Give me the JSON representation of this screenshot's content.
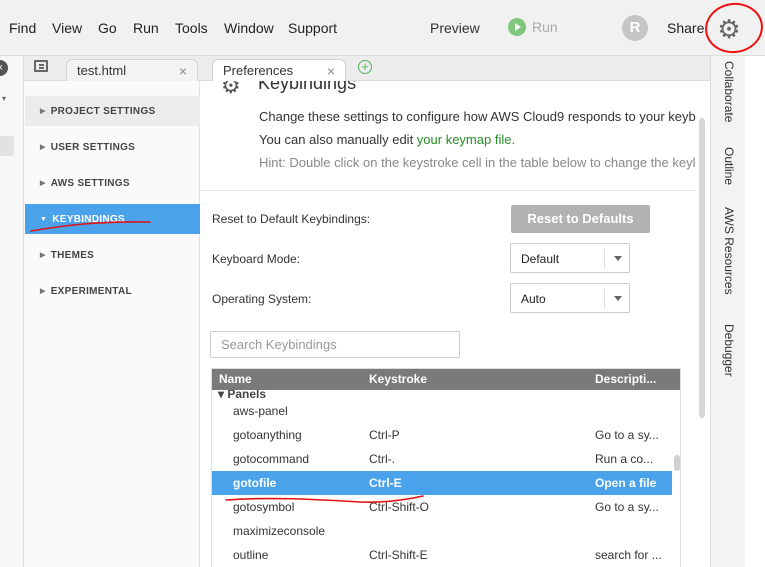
{
  "menubar": {
    "items": [
      "Find",
      "View",
      "Go",
      "Run",
      "Tools",
      "Window",
      "Support"
    ],
    "preview": "Preview",
    "run": "Run",
    "avatar_letter": "R",
    "share": "Share",
    "gear_icon": "gear-icon"
  },
  "left_strip": {
    "close_icon": "close-icon",
    "arrow": "▾"
  },
  "tabs": [
    {
      "label": "test.html",
      "close": "×"
    },
    {
      "label": "Preferences",
      "close": "×"
    }
  ],
  "tab_add": "+",
  "prefnav": {
    "items": [
      {
        "label": "PROJECT SETTINGS",
        "state": "hover"
      },
      {
        "label": "USER SETTINGS",
        "state": ""
      },
      {
        "label": "AWS SETTINGS",
        "state": ""
      },
      {
        "label": "KEYBINDINGS",
        "state": "active"
      },
      {
        "label": "THEMES",
        "state": ""
      },
      {
        "label": "EXPERIMENTAL",
        "state": ""
      }
    ]
  },
  "content": {
    "title": "Keybindings",
    "intro1": "Change these settings to configure how AWS Cloud9 responds to your keyb",
    "intro2_prefix": "You can also manually edit ",
    "intro2_link": "your keymap file.",
    "intro3": "Hint: Double click on the keystroke cell in the table below to change the keyl",
    "reset_label": "Reset to Default Keybindings:",
    "reset_button": "Reset to Defaults",
    "mode_label": "Keyboard Mode:",
    "mode_value": "Default",
    "os_label": "Operating System:",
    "os_value": "Auto",
    "search_placeholder": "Search Keybindings"
  },
  "table": {
    "columns": [
      "Name",
      "Keystroke",
      "Descripti..."
    ],
    "group": "▾ Panels",
    "rows": [
      {
        "name": "aws-panel",
        "keystroke": "",
        "description": "",
        "selected": false
      },
      {
        "name": "gotoanything",
        "keystroke": "Ctrl-P",
        "description": "Go to a sy...",
        "selected": false
      },
      {
        "name": "gotocommand",
        "keystroke": "Ctrl-.",
        "description": "Run a co...",
        "selected": false
      },
      {
        "name": "gotofile",
        "keystroke": "Ctrl-E",
        "description": "Open a file",
        "selected": true
      },
      {
        "name": "gotosymbol",
        "keystroke": "Ctrl-Shift-O",
        "description": "Go to a sy...",
        "selected": false
      },
      {
        "name": "maximizeconsole",
        "keystroke": "",
        "description": "",
        "selected": false
      },
      {
        "name": "outline",
        "keystroke": "Ctrl-Shift-E",
        "description": "search for ...",
        "selected": false
      }
    ]
  },
  "rightpanel": [
    "Collaborate",
    "Outline",
    "AWS Resources",
    "Debugger"
  ],
  "colors": {
    "accent": "#4aa3ea",
    "link": "#2a8c2a",
    "annotation": "#e11111"
  }
}
